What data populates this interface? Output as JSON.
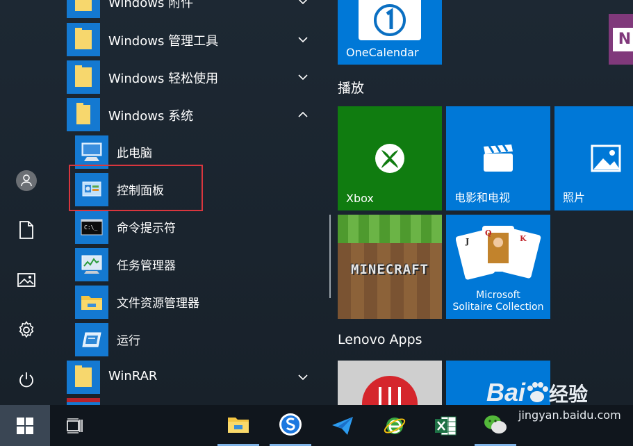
{
  "app_list": {
    "groups": [
      {
        "label": "Windows 附件"
      },
      {
        "label": "Windows 管理工具"
      },
      {
        "label": "Windows 轻松使用"
      },
      {
        "label": "Windows 系统"
      }
    ],
    "system_items": [
      {
        "label": "此电脑",
        "icon": "computer-icon"
      },
      {
        "label": "控制面板",
        "icon": "control-panel-icon"
      },
      {
        "label": "命令提示符",
        "icon": "cmd-icon"
      },
      {
        "label": "任务管理器",
        "icon": "task-manager-icon"
      },
      {
        "label": "文件资源管理器",
        "icon": "explorer-icon"
      },
      {
        "label": "运行",
        "icon": "run-icon"
      }
    ],
    "winrar": {
      "label": "WinRAR"
    }
  },
  "tiles": {
    "onecalendar": {
      "label": "OneCalendar"
    },
    "play_header": "播放",
    "xbox": {
      "label": "Xbox"
    },
    "movies": {
      "label": "电影和电视"
    },
    "photos": {
      "label": "照片"
    },
    "minecraft": {
      "label": "MINECRAFT"
    },
    "solitaire": {
      "line1": "Microsoft",
      "line2": "Solitaire Collection"
    },
    "lenovo_header": "Lenovo Apps",
    "onenote": {
      "label": "N"
    }
  },
  "colors": {
    "tile_blue": "#0078d7",
    "xbox_green": "#107c10",
    "highlight_red": "#d9363e",
    "onenote_purple": "#80397b"
  },
  "watermark": {
    "brand": "Bai",
    "brand2": "经验",
    "url": "jingyan.baidu.com"
  }
}
